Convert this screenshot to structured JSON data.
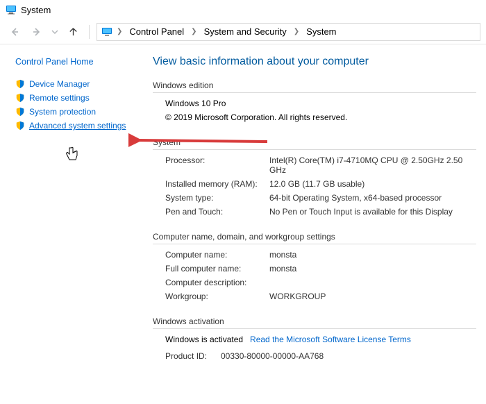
{
  "window": {
    "title": "System"
  },
  "breadcrumbs": {
    "a": "Control Panel",
    "b": "System and Security",
    "c": "System"
  },
  "sidebar": {
    "home": "Control Panel Home",
    "items": [
      {
        "label": "Device Manager"
      },
      {
        "label": "Remote settings"
      },
      {
        "label": "System protection"
      },
      {
        "label": "Advanced system settings"
      }
    ]
  },
  "page": {
    "title": "View basic information about your computer",
    "sections": {
      "edition": {
        "head": "Windows edition",
        "product": "Windows 10 Pro",
        "copyright": "© 2019 Microsoft Corporation. All rights reserved."
      },
      "system": {
        "head": "System",
        "rows": {
          "processor_k": "Processor:",
          "processor_v": "Intel(R) Core(TM) i7-4710MQ CPU @ 2.50GHz   2.50 GHz",
          "ram_k": "Installed memory (RAM):",
          "ram_v": "12.0 GB (11.7 GB usable)",
          "type_k": "System type:",
          "type_v": "64-bit Operating System, x64-based processor",
          "pen_k": "Pen and Touch:",
          "pen_v": "No Pen or Touch Input is available for this Display"
        }
      },
      "name": {
        "head": "Computer name, domain, and workgroup settings",
        "rows": {
          "cname_k": "Computer name:",
          "cname_v": "monsta",
          "full_k": "Full computer name:",
          "full_v": "monsta",
          "desc_k": "Computer description:",
          "desc_v": "",
          "wg_k": "Workgroup:",
          "wg_v": "WORKGROUP"
        }
      },
      "activation": {
        "head": "Windows activation",
        "status": "Windows is activated",
        "link": "Read the Microsoft Software License Terms",
        "pid_k": "Product ID:",
        "pid_v": "00330-80000-00000-AA768"
      }
    }
  }
}
